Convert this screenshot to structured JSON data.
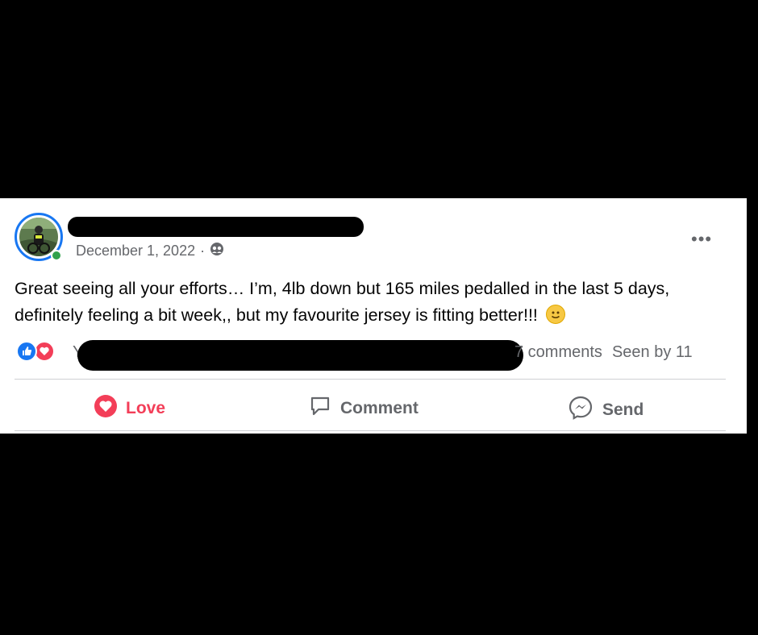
{
  "post": {
    "date": "December 1, 2022",
    "separator": "·",
    "audience_icon": "friends-icon",
    "more_label": "•••",
    "text": "Great seeing all your efforts… I’m, 4lb down but 165 miles pedalled in the last 5 days, definitely feeling a bit week,,  but my favourite jersey is fitting better!!!",
    "emoji": "slightly-smiling-face-icon"
  },
  "reactions": {
    "types": [
      "like-icon",
      "love-icon"
    ],
    "count_prefix": "Y",
    "comments_label": "7 comments",
    "seen_by_label": "Seen by 11"
  },
  "actions": {
    "love_label": "Love",
    "comment_label": "Comment",
    "send_label": "Send"
  },
  "colors": {
    "accent": "#1877f2",
    "love": "#f33e58",
    "online": "#31a24c",
    "muted_text": "#65676b"
  }
}
